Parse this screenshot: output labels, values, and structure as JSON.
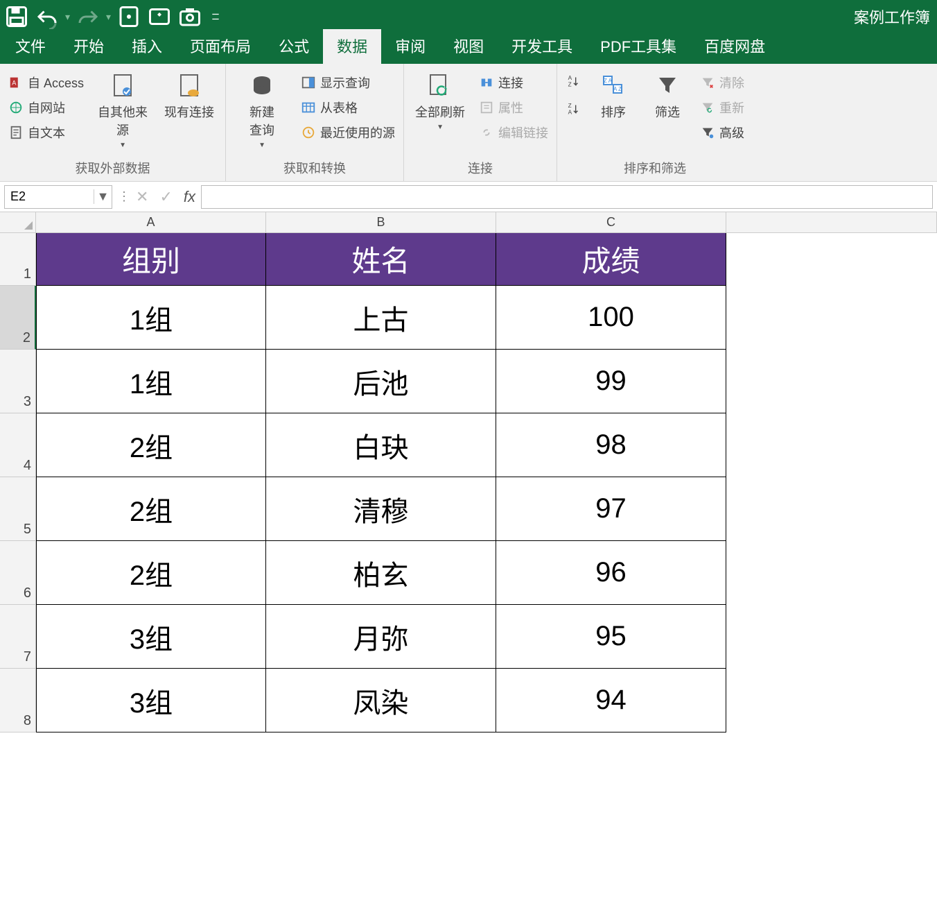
{
  "title": "案例工作簿",
  "qat": {
    "save": "save",
    "undo": "undo",
    "redo": "redo",
    "touch": "touch",
    "addin": "addin",
    "camera": "camera",
    "customize": "customize"
  },
  "tabs": {
    "file": "文件",
    "home": "开始",
    "insert": "插入",
    "layout": "页面布局",
    "formulas": "公式",
    "data": "数据",
    "review": "审阅",
    "view": "视图",
    "developer": "开发工具",
    "pdftools": "PDF工具集",
    "baidu": "百度网盘"
  },
  "ribbon": {
    "get_external": {
      "from_access": "自 Access",
      "from_web": "自网站",
      "from_text": "自文本",
      "from_other": "自其他来源",
      "existing_conn": "现有连接",
      "caption": "获取外部数据"
    },
    "get_transform": {
      "new_query": "新建\n查询",
      "show_queries": "显示查询",
      "from_table": "从表格",
      "recent_sources": "最近使用的源",
      "caption": "获取和转换"
    },
    "connections": {
      "refresh_all": "全部刷新",
      "connections": "连接",
      "properties": "属性",
      "edit_links": "编辑链接",
      "caption": "连接"
    },
    "sort_filter": {
      "sort_asc": "A→Z",
      "sort_desc": "Z→A",
      "sort": "排序",
      "filter": "筛选",
      "clear": "清除",
      "reapply": "重新",
      "advanced": "高级",
      "caption": "排序和筛选"
    }
  },
  "formula_bar": {
    "namebox_value": "E2",
    "cancel": "✕",
    "enter": "✓",
    "fx": "fx",
    "formula_value": ""
  },
  "columns": [
    "A",
    "B",
    "C"
  ],
  "row_numbers": [
    "1",
    "2",
    "3",
    "4",
    "5",
    "6",
    "7",
    "8"
  ],
  "selected_row_index": 1,
  "table": {
    "headers": {
      "col_a": "组别",
      "col_b": "姓名",
      "col_c": "成绩"
    },
    "rows": [
      {
        "a": "1组",
        "b": "上古",
        "c": "100"
      },
      {
        "a": "1组",
        "b": "后池",
        "c": "99"
      },
      {
        "a": "2组",
        "b": "白玦",
        "c": "98"
      },
      {
        "a": "2组",
        "b": "清穆",
        "c": "97"
      },
      {
        "a": "2组",
        "b": "柏玄",
        "c": "96"
      },
      {
        "a": "3组",
        "b": "月弥",
        "c": "95"
      },
      {
        "a": "3组",
        "b": "凤染",
        "c": "94"
      }
    ]
  }
}
